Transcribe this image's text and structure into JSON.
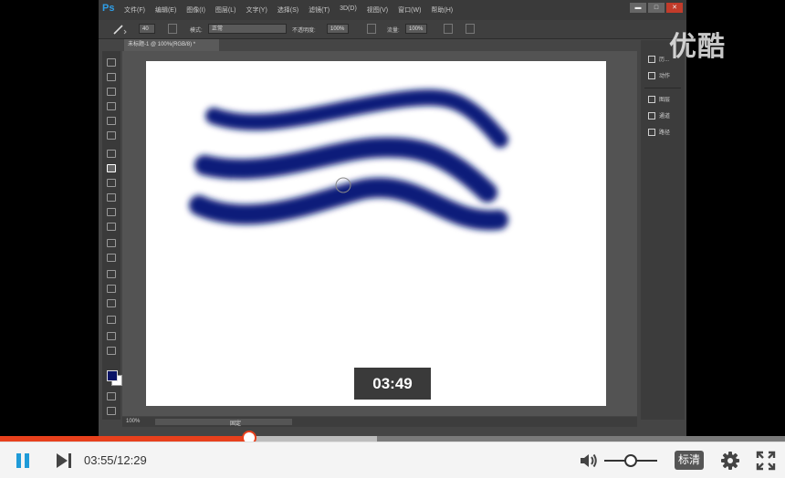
{
  "photoshop": {
    "logo": "Ps",
    "menu": [
      "文件(F)",
      "编辑(E)",
      "图像(I)",
      "图层(L)",
      "文字(Y)",
      "选择(S)",
      "滤镜(T)",
      "3D(D)",
      "视图(V)",
      "窗口(W)",
      "帮助(H)"
    ],
    "options": {
      "size": "40",
      "mode_label": "模式:",
      "mode_value": "正常",
      "opacity_label": "不透明度:",
      "opacity_value": "100%",
      "flow_label": "流量:",
      "flow_value": "100%"
    },
    "document_tab": "未标题-1 @ 100%(RGB/8) *",
    "status": {
      "zoom": "100%",
      "text": "固定"
    },
    "panels": [
      {
        "label": "历..."
      },
      {
        "label": "动作"
      },
      {
        "label": "图层"
      },
      {
        "label": "通道"
      },
      {
        "label": "路径"
      }
    ],
    "foreground_color": "#0b1466",
    "stroke_color": "#0d1a7a"
  },
  "watermark": "优酷",
  "seek_preview_time": "03:49",
  "player": {
    "current_time": "03:55",
    "total_time": "12:29",
    "progress_fraction": 0.318,
    "buffered_fraction": 0.48,
    "volume_fraction": 0.5,
    "quality_label": "标清",
    "accent_color": "#e8401c"
  }
}
